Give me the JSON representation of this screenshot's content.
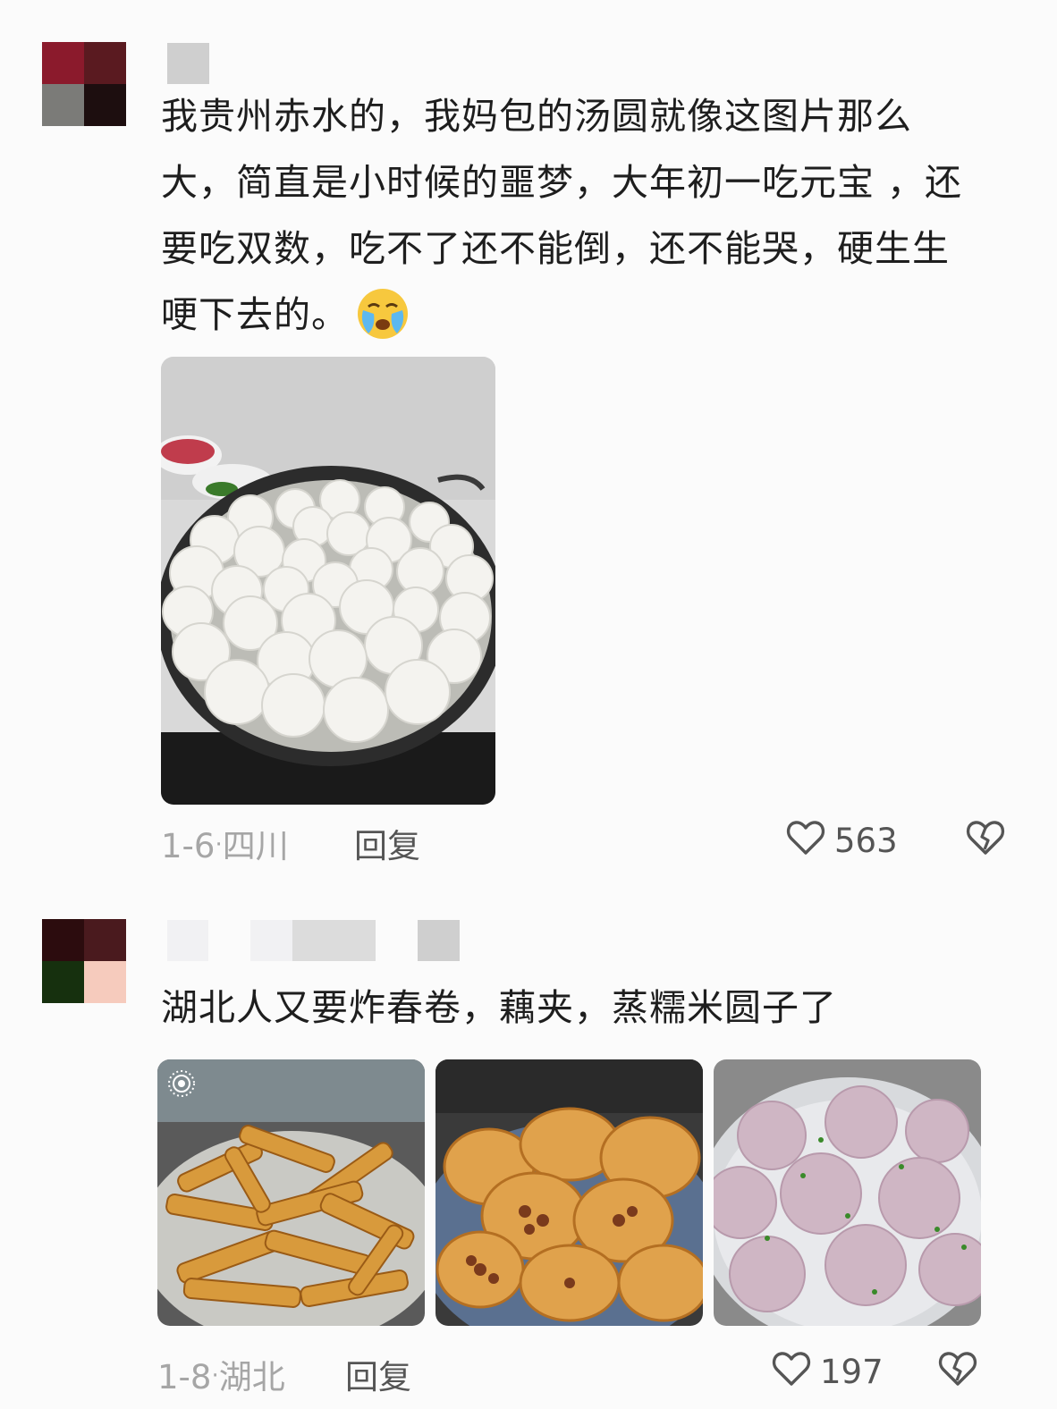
{
  "comments": [
    {
      "avatar_colors": [
        "#8b1a2c",
        "#5a1a20",
        "#7b7b78",
        "#1d0e0f"
      ],
      "text_lines": [
        "我贵州赤水的，我妈包的汤圆就像这图片那么",
        "大，简直是小时候的噩梦，大年初一吃元宝 ，还",
        "要吃双数，吃不了还不能倒，还不能哭，硬生生",
        "哽下去的。"
      ],
      "emoji": "crying-face",
      "images": [
        {
          "subject": "tangyuan-in-wok"
        }
      ],
      "date": "1-6",
      "location": "四川",
      "reply_label": "回复",
      "like_count": "563"
    },
    {
      "avatar_colors": [
        "#2c0c0e",
        "#4a1a1e",
        "#16300e",
        "#f6cbbd"
      ],
      "text_lines": [
        "湖北人又要炸春卷，藕夹，蒸糯米圆子了"
      ],
      "images": [
        {
          "subject": "fried-spring-rolls"
        },
        {
          "subject": "fried-lotus-root-sandwich"
        },
        {
          "subject": "steamed-glutinous-rice-balls"
        }
      ],
      "date": "1-8",
      "location": "湖北",
      "reply_label": "回复",
      "like_count": "197"
    }
  ],
  "separator": "·",
  "colors": {
    "meta_text": "#a6a6a6",
    "action_text": "#555555"
  },
  "icons": [
    "heart-outline-icon",
    "broken-heart-icon",
    "live-photo-icon"
  ]
}
